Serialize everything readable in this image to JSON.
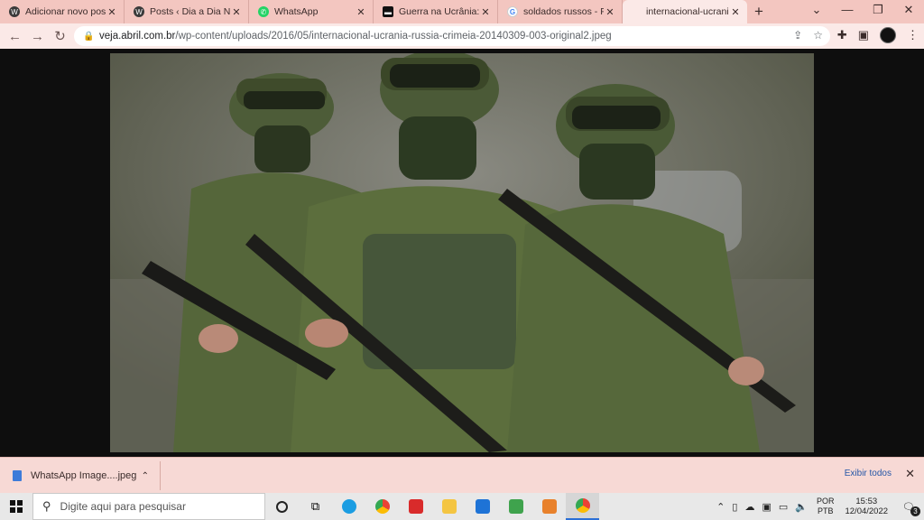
{
  "browser": {
    "tabs": [
      {
        "label": "Adicionar novo post ‹",
        "icon": "wordpress-icon"
      },
      {
        "label": "Posts ‹ Dia a Dia Notíc",
        "icon": "wordpress-icon"
      },
      {
        "label": "WhatsApp",
        "icon": "whatsapp-icon"
      },
      {
        "label": "Guerra na Ucrânia: 'So",
        "icon": "news-icon"
      },
      {
        "label": "soldados russos - Pesq",
        "icon": "google-icon"
      },
      {
        "label": "internacional-ucrania-",
        "icon": "image-icon"
      }
    ],
    "url_host": "veja.abril.com.br",
    "url_path": "/wp-content/uploads/2016/05/internacional-ucrania-russia-crimeia-20140309-003-original2.jpeg"
  },
  "image": {
    "description_label": "photo"
  },
  "downloads": {
    "item_label": "WhatsApp Image....jpeg",
    "show_all": "Exibir todos"
  },
  "taskbar": {
    "search_placeholder": "Digite aqui para pesquisar",
    "lang_top": "POR",
    "lang_bottom": "PTB",
    "time": "15:53",
    "date": "12/04/2022",
    "notifications": "3"
  }
}
